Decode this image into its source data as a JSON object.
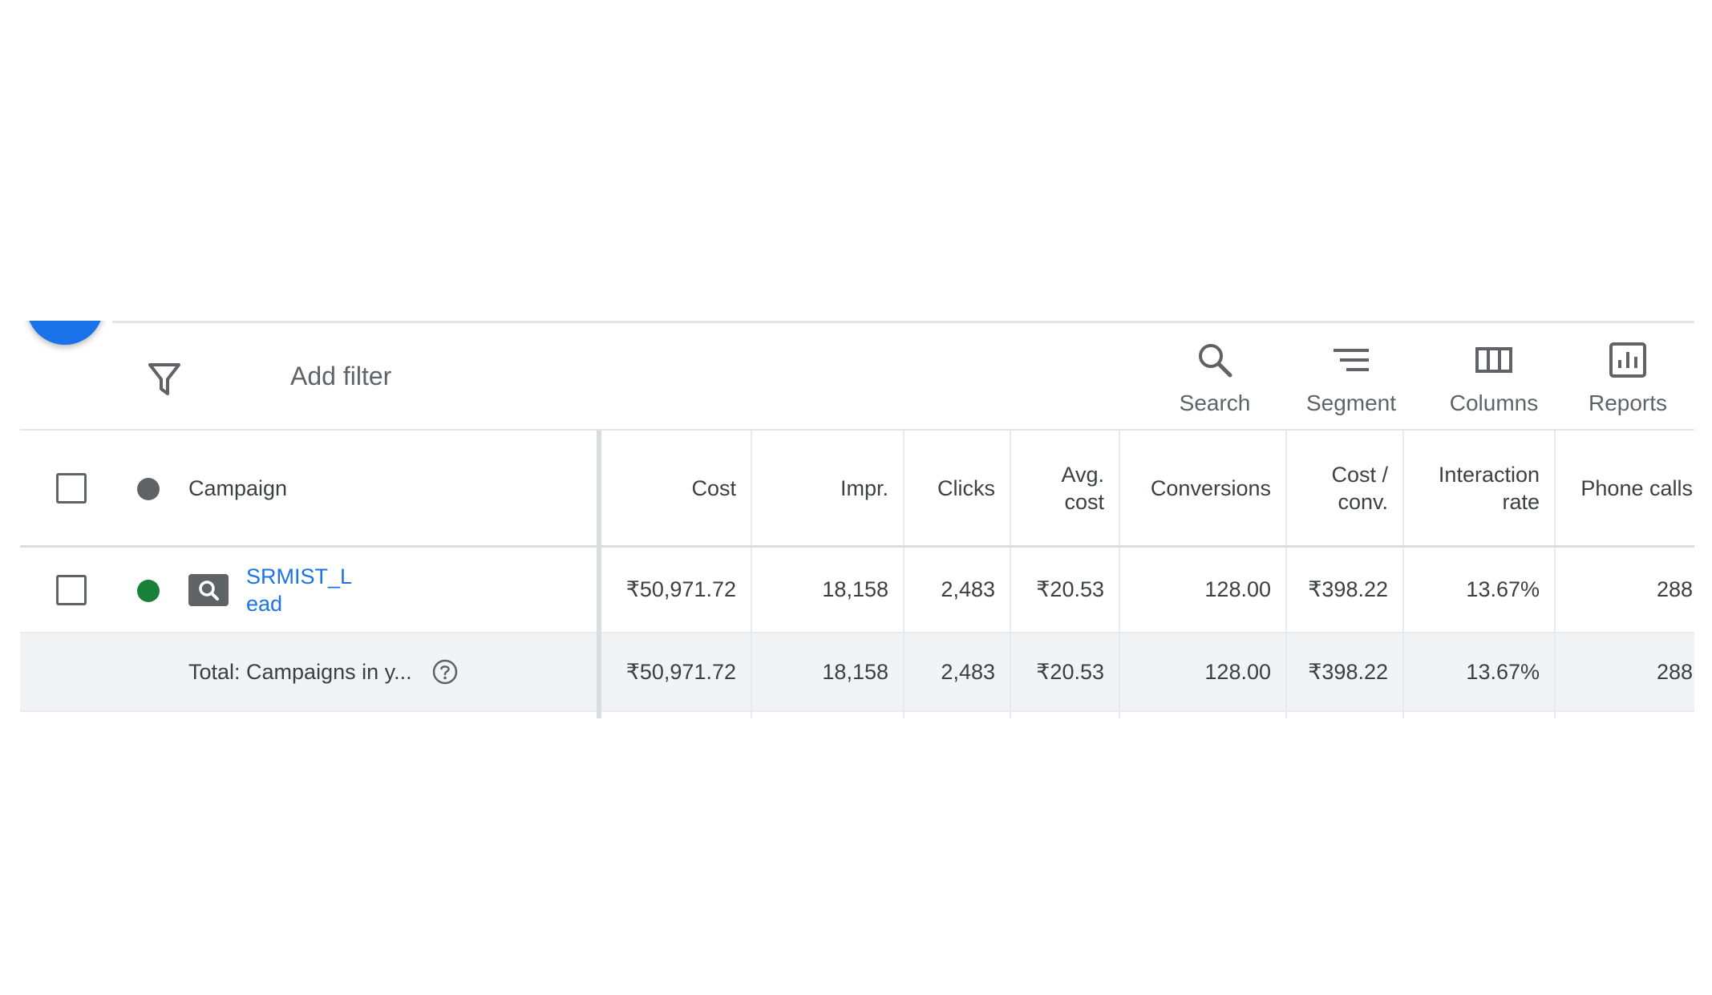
{
  "toolbar": {
    "add_filter_label": "Add filter",
    "tools": {
      "search": "Search",
      "segment": "Segment",
      "columns": "Columns",
      "reports": "Reports"
    }
  },
  "table": {
    "columns": {
      "campaign": "Campaign",
      "cost": "Cost",
      "impr": "Impr.",
      "clicks": "Clicks",
      "avg_cost": "Avg. cost",
      "conversions": "Conversions",
      "cost_per_conv": "Cost / conv.",
      "interaction_rate": "Interaction rate",
      "phone_calls": "Phone calls"
    },
    "rows": [
      {
        "campaign": "SRMIST_Lead",
        "status": "enabled",
        "campaign_type_icon": "search-campaign-icon",
        "cost": "₹50,971.72",
        "impr": "18,158",
        "clicks": "2,483",
        "avg_cost": "₹20.53",
        "conversions": "128.00",
        "cost_per_conv": "₹398.22",
        "interaction_rate": "13.67%",
        "phone_calls": "288"
      }
    ],
    "total": {
      "label": "Total: Campaigns in y...",
      "cost": "₹50,971.72",
      "impr": "18,158",
      "clicks": "2,483",
      "avg_cost": "₹20.53",
      "conversions": "128.00",
      "cost_per_conv": "₹398.22",
      "interaction_rate": "13.67%",
      "phone_calls": "288"
    }
  },
  "colors": {
    "accent": "#1a73e8",
    "status_enabled": "#188038",
    "status_header": "#5f6368"
  }
}
